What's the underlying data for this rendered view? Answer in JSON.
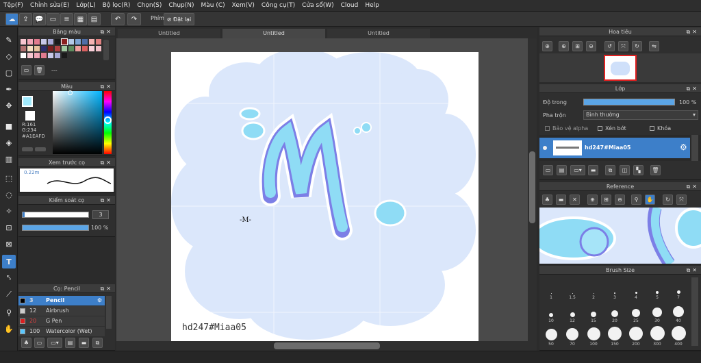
{
  "menu": [
    "Tệp(F)",
    "Chỉnh sửa(E)",
    "Lớp(L)",
    "Bộ lọc(R)",
    "Chọn(S)",
    "Chụp(N)",
    "Màu (C)",
    "Xem(V)",
    "Công cụ(T)",
    "Cửa sổ(W)",
    "Cloud",
    "Help"
  ],
  "toolbar": {
    "phim_label": "Phím",
    "reset_label": "Đặt lại"
  },
  "tabs": [
    "Untitled",
    "Untitled",
    "Untitled"
  ],
  "palette": {
    "title": "Bảng màu",
    "footer": "---"
  },
  "color": {
    "title": "Màu",
    "r": "R:161",
    "g": "G:234",
    "hex": "#A1EAFD",
    "current": "#a1eafd"
  },
  "brush_preview": {
    "title": "Xem trước cọ",
    "size": "0.22m"
  },
  "brush_control": {
    "title": "Kiểm soát cọ",
    "size": "3",
    "opacity": "100 %"
  },
  "brush_list": {
    "title": "Cọ: Pencil",
    "items": [
      {
        "size": "3",
        "name": "Pencil",
        "color": "#000000",
        "active": true
      },
      {
        "size": "12",
        "name": "Airbrush",
        "color": "#cccccc",
        "active": false
      },
      {
        "size": "20",
        "name": "G Pen",
        "color": "#d81f1f",
        "active": false
      },
      {
        "size": "100",
        "name": "Watercolor (Wet)",
        "color": "#5ac8ff",
        "active": false
      }
    ]
  },
  "navigator": {
    "title": "Hoa tiêu"
  },
  "layer": {
    "title": "Lớp",
    "opacity_label": "Độ trong",
    "opacity_value": "100 %",
    "blend_label": "Pha trộn",
    "blend_value": "Bình thường",
    "protect_alpha": "Bảo vệ alpha",
    "clipping": "Xén bớt",
    "lock": "Khóa",
    "layer_name": "hd247#Miaa05"
  },
  "reference": {
    "title": "Reference"
  },
  "brush_size": {
    "title": "Brush Size",
    "sizes": [
      "1",
      "1.5",
      "2",
      "3",
      "4",
      "5",
      "7",
      "10",
      "12",
      "15",
      "20",
      "25",
      "30",
      "40",
      "50",
      "70",
      "100",
      "150",
      "200",
      "300",
      "400"
    ]
  },
  "canvas": {
    "watermark": "hd247#Miaa05",
    "small_sig": "-M-",
    "letter": "M"
  }
}
